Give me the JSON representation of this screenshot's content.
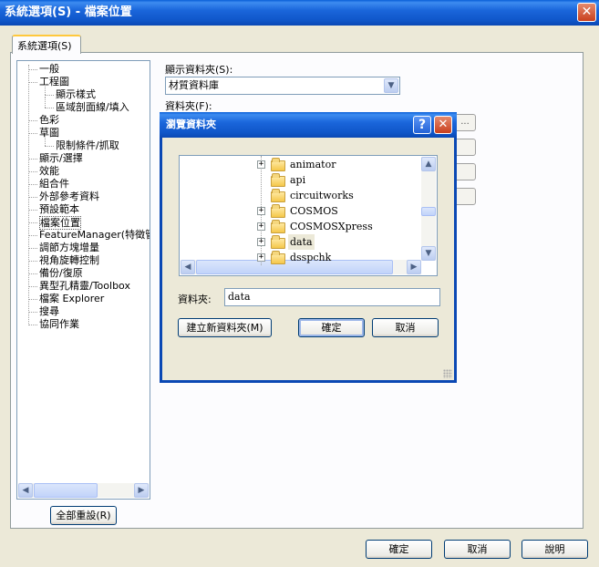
{
  "window": {
    "title": "系統選項(S) - 檔案位置",
    "close_glyph": "✕"
  },
  "tab": {
    "label": "系統選項(S)"
  },
  "tree": {
    "items": [
      {
        "label": "一般",
        "level": 0
      },
      {
        "label": "工程圖",
        "level": 0
      },
      {
        "label": "顯示樣式",
        "level": 1
      },
      {
        "label": "區域剖面線/填入",
        "level": 1
      },
      {
        "label": "色彩",
        "level": 0
      },
      {
        "label": "草圖",
        "level": 0
      },
      {
        "label": "限制條件/抓取",
        "level": 1
      },
      {
        "label": "顯示/選擇",
        "level": 0
      },
      {
        "label": "效能",
        "level": 0
      },
      {
        "label": "組合件",
        "level": 0
      },
      {
        "label": "外部參考資料",
        "level": 0
      },
      {
        "label": "預設範本",
        "level": 0
      },
      {
        "label": "檔案位置",
        "level": 0,
        "selected": true
      },
      {
        "label": "FeatureManager(特徵管理",
        "level": 0
      },
      {
        "label": "調節方塊增量",
        "level": 0
      },
      {
        "label": "視角旋轉控制",
        "level": 0
      },
      {
        "label": "備份/復原",
        "level": 0
      },
      {
        "label": "異型孔精靈/Toolbox",
        "level": 0
      },
      {
        "label": "檔案 Explorer",
        "level": 0
      },
      {
        "label": "搜尋",
        "level": 0
      },
      {
        "label": "協同作業",
        "level": 0
      }
    ],
    "reset_button": "全部重設(R)"
  },
  "settings": {
    "show_folder_label": "顯示資料夾(S):",
    "show_folder_value": "材質資料庫",
    "folder_label": "資料夾(F):",
    "browse_label": "..."
  },
  "dialog": {
    "title": "瀏覽資料夾",
    "help_glyph": "?",
    "close_glyph": "✕",
    "folders": [
      {
        "name": "animator",
        "expandable": true
      },
      {
        "name": "api",
        "expandable": false
      },
      {
        "name": "circuitworks",
        "expandable": false
      },
      {
        "name": "COSMOS",
        "expandable": true
      },
      {
        "name": "COSMOSXpress",
        "expandable": true
      },
      {
        "name": "data",
        "expandable": true,
        "selected": true
      },
      {
        "name": "dsspchk",
        "expandable": true
      }
    ],
    "folder_field_label": "資料夾:",
    "folder_field_value": "data",
    "new_folder_button": "建立新資料夾(M)",
    "ok_button": "確定",
    "cancel_button": "取消"
  },
  "footer": {
    "ok_button": "確定",
    "cancel_button": "取消",
    "help_button": "說明"
  },
  "icons": {
    "left": "◀",
    "right": "▶",
    "up": "▲",
    "down": "▼",
    "plus": "+"
  }
}
